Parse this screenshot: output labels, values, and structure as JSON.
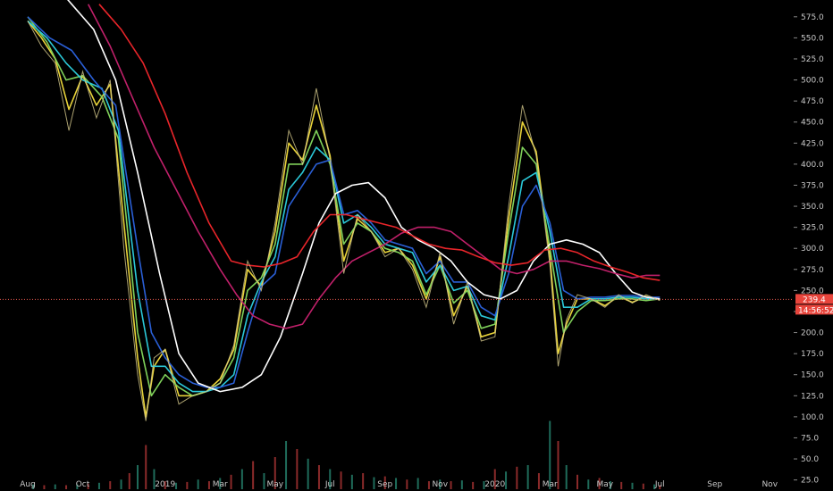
{
  "chart_data": {
    "type": "line",
    "ylim": [
      14,
      578
    ],
    "grid": false,
    "y_ticks": [
      25.0,
      50.0,
      75.0,
      100.0,
      125.0,
      150.0,
      175.0,
      200.0,
      225.0,
      250.0,
      275.0,
      300.0,
      325.0,
      350.0,
      375.0,
      400.0,
      425.0,
      450.0,
      475.0,
      500.0,
      525.0,
      550.0,
      575.0
    ],
    "x_ticks": [
      {
        "t": 0,
        "label": "Aug"
      },
      {
        "t": 2,
        "label": "Oct"
      },
      {
        "t": 5,
        "label": "2019"
      },
      {
        "t": 7,
        "label": "Mar"
      },
      {
        "t": 9,
        "label": "May"
      },
      {
        "t": 11,
        "label": "Jul"
      },
      {
        "t": 13,
        "label": "Sep"
      },
      {
        "t": 15,
        "label": "Nov"
      },
      {
        "t": 17,
        "label": "2020"
      },
      {
        "t": 19,
        "label": "Mar"
      },
      {
        "t": 21,
        "label": "May"
      },
      {
        "t": 23,
        "label": "Jul"
      },
      {
        "t": 25,
        "label": "Sep"
      },
      {
        "t": 27,
        "label": "Nov"
      }
    ],
    "current_price": {
      "value": 239.4,
      "label": "239.4",
      "countdown": "14:56:52"
    },
    "price_series": {
      "color": "#d6c98c",
      "t": [
        0.0,
        0.5,
        1.0,
        1.5,
        2.0,
        2.5,
        3.0,
        3.5,
        4.0,
        4.3,
        4.6,
        5.0,
        5.5,
        6.0,
        6.5,
        7.0,
        7.5,
        8.0,
        8.5,
        9.0,
        9.5,
        10.0,
        10.5,
        11.0,
        11.5,
        12.0,
        12.5,
        13.0,
        13.5,
        14.0,
        14.5,
        15.0,
        15.5,
        16.0,
        16.5,
        17.0,
        17.5,
        18.0,
        18.5,
        19.0,
        19.3,
        19.6,
        20.0,
        20.5,
        21.0,
        21.5,
        22.0,
        22.5,
        23.0
      ],
      "values": [
        570,
        540,
        520,
        440,
        510,
        455,
        500,
        300,
        150,
        95,
        170,
        180,
        115,
        125,
        130,
        140,
        185,
        285,
        250,
        330,
        440,
        400,
        490,
        405,
        270,
        340,
        320,
        290,
        300,
        275,
        230,
        295,
        210,
        260,
        190,
        195,
        350,
        470,
        410,
        280,
        160,
        215,
        245,
        240,
        230,
        245,
        235,
        245,
        238
      ]
    },
    "series": [
      {
        "color": "#e8d33a",
        "t": [
          0.0,
          0.5,
          1.0,
          1.5,
          2.0,
          2.5,
          3.0,
          3.5,
          4.0,
          4.3,
          4.6,
          5.0,
          5.5,
          6.0,
          6.5,
          7.0,
          7.5,
          8.0,
          8.5,
          9.0,
          9.5,
          10.0,
          10.5,
          11.0,
          11.5,
          12.0,
          12.5,
          13.0,
          13.5,
          14.0,
          14.5,
          15.0,
          15.5,
          16.0,
          16.5,
          17.0,
          17.5,
          18.0,
          18.5,
          19.0,
          19.3,
          19.6,
          20.0,
          20.5,
          21.0,
          21.5,
          22.0,
          22.5,
          23.0
        ],
        "values": [
          570,
          550,
          525,
          465,
          505,
          470,
          495,
          330,
          170,
          100,
          160,
          180,
          125,
          125,
          130,
          145,
          180,
          275,
          255,
          320,
          425,
          405,
          470,
          410,
          285,
          335,
          320,
          295,
          300,
          280,
          240,
          290,
          220,
          255,
          195,
          200,
          335,
          450,
          415,
          290,
          175,
          210,
          240,
          240,
          232,
          243,
          236,
          243,
          239
        ]
      },
      {
        "color": "#7fd05a",
        "t": [
          0.0,
          0.7,
          1.4,
          2.0,
          2.7,
          3.3,
          4.0,
          4.5,
          5.0,
          5.5,
          6.0,
          6.5,
          7.0,
          7.5,
          8.0,
          8.5,
          9.0,
          9.5,
          10.0,
          10.5,
          11.0,
          11.5,
          12.0,
          12.5,
          13.0,
          13.5,
          14.0,
          14.5,
          15.0,
          15.5,
          16.0,
          16.5,
          17.0,
          17.5,
          18.0,
          18.5,
          19.0,
          19.5,
          20.0,
          20.5,
          21.0,
          21.5,
          22.0,
          22.5,
          23.0
        ],
        "values": [
          575,
          545,
          500,
          505,
          480,
          430,
          200,
          125,
          150,
          135,
          125,
          130,
          140,
          170,
          250,
          265,
          305,
          400,
          400,
          440,
          400,
          305,
          330,
          320,
          300,
          295,
          285,
          245,
          280,
          235,
          250,
          205,
          210,
          320,
          420,
          400,
          300,
          200,
          225,
          238,
          238,
          240,
          240,
          238,
          240
        ]
      },
      {
        "color": "#2bc8d8",
        "t": [
          0.0,
          0.7,
          1.4,
          2.0,
          2.7,
          3.3,
          4.0,
          4.5,
          5.0,
          5.5,
          6.0,
          6.5,
          7.0,
          7.5,
          8.0,
          8.5,
          9.0,
          9.5,
          10.0,
          10.5,
          11.0,
          11.5,
          12.0,
          12.5,
          13.0,
          13.5,
          14.0,
          14.5,
          15.0,
          15.5,
          16.0,
          16.5,
          17.0,
          17.5,
          18.0,
          18.5,
          19.0,
          19.5,
          20.0,
          20.5,
          21.0,
          21.5,
          22.0,
          22.5,
          23.0
        ],
        "values": [
          570,
          550,
          520,
          500,
          490,
          440,
          250,
          160,
          160,
          140,
          130,
          130,
          135,
          150,
          220,
          260,
          290,
          370,
          390,
          420,
          405,
          330,
          340,
          325,
          305,
          300,
          295,
          260,
          280,
          250,
          255,
          220,
          215,
          290,
          380,
          390,
          320,
          230,
          230,
          240,
          240,
          242,
          242,
          240,
          240
        ]
      },
      {
        "color": "#2a5fd6",
        "t": [
          0.0,
          0.8,
          1.6,
          2.4,
          3.2,
          4.0,
          4.5,
          5.0,
          5.5,
          6.0,
          6.5,
          7.0,
          7.5,
          8.0,
          8.5,
          9.0,
          9.5,
          10.0,
          10.5,
          11.0,
          11.5,
          12.0,
          12.5,
          13.0,
          13.5,
          14.0,
          14.5,
          15.0,
          15.5,
          16.0,
          16.5,
          17.0,
          17.5,
          18.0,
          18.5,
          19.0,
          19.5,
          20.0,
          20.5,
          21.0,
          21.5,
          22.0,
          22.5,
          23.0
        ],
        "values": [
          575,
          550,
          535,
          500,
          470,
          300,
          200,
          170,
          150,
          140,
          135,
          135,
          140,
          200,
          255,
          270,
          350,
          375,
          400,
          405,
          340,
          345,
          330,
          310,
          305,
          300,
          270,
          285,
          260,
          260,
          230,
          220,
          270,
          350,
          375,
          330,
          250,
          240,
          242,
          242,
          244,
          244,
          242,
          242
        ]
      },
      {
        "color": "#ffffff",
        "t": [
          0.0,
          0.8,
          1.6,
          2.4,
          3.2,
          4.0,
          4.8,
          5.5,
          6.2,
          7.0,
          7.8,
          8.5,
          9.2,
          10.0,
          10.6,
          11.2,
          11.8,
          12.4,
          13.0,
          13.6,
          14.2,
          14.8,
          15.4,
          16.0,
          16.6,
          17.2,
          17.8,
          18.4,
          19.0,
          19.6,
          20.2,
          20.8,
          21.4,
          22.0,
          22.5,
          23.0
        ],
        "values": [
          660,
          620,
          590,
          560,
          500,
          390,
          270,
          175,
          140,
          130,
          135,
          150,
          195,
          270,
          330,
          365,
          375,
          378,
          360,
          325,
          310,
          300,
          285,
          260,
          245,
          240,
          250,
          285,
          305,
          310,
          305,
          295,
          270,
          248,
          242,
          240
        ]
      },
      {
        "color": "#c0206a",
        "t": [
          2.2,
          3.0,
          3.8,
          4.6,
          5.4,
          6.2,
          7.0,
          7.6,
          8.2,
          8.8,
          9.4,
          10.0,
          10.6,
          11.2,
          11.8,
          12.4,
          13.0,
          13.6,
          14.2,
          14.8,
          15.4,
          16.0,
          16.6,
          17.2,
          17.8,
          18.4,
          19.0,
          19.6,
          20.2,
          20.8,
          21.4,
          22.0,
          22.5,
          23.0
        ],
        "values": [
          590,
          540,
          480,
          420,
          370,
          320,
          275,
          245,
          220,
          210,
          205,
          210,
          240,
          265,
          285,
          295,
          305,
          318,
          325,
          325,
          320,
          305,
          290,
          275,
          270,
          275,
          285,
          285,
          280,
          276,
          270,
          265,
          268,
          268
        ]
      },
      {
        "color": "#e8252a",
        "t": [
          2.6,
          3.4,
          4.2,
          5.0,
          5.8,
          6.6,
          7.4,
          8.0,
          8.6,
          9.2,
          9.8,
          10.4,
          11.0,
          11.6,
          12.2,
          12.8,
          13.4,
          14.0,
          14.6,
          15.2,
          15.8,
          16.4,
          17.0,
          17.6,
          18.2,
          18.8,
          19.4,
          20.0,
          20.6,
          21.2,
          21.8,
          22.4,
          23.0
        ],
        "values": [
          590,
          560,
          520,
          460,
          390,
          330,
          285,
          280,
          278,
          282,
          290,
          320,
          340,
          340,
          335,
          330,
          325,
          315,
          305,
          300,
          298,
          290,
          283,
          280,
          283,
          298,
          300,
          295,
          285,
          278,
          272,
          265,
          262
        ]
      }
    ],
    "volume": {
      "t": [
        0.2,
        0.6,
        1.0,
        1.4,
        1.8,
        2.2,
        2.6,
        3.0,
        3.4,
        3.7,
        4.0,
        4.3,
        4.6,
        5.0,
        5.4,
        5.8,
        6.2,
        6.6,
        7.0,
        7.4,
        7.8,
        8.2,
        8.6,
        9.0,
        9.4,
        9.8,
        10.2,
        10.6,
        11.0,
        11.4,
        11.8,
        12.2,
        12.6,
        13.0,
        13.4,
        13.8,
        14.2,
        14.6,
        15.0,
        15.4,
        15.8,
        16.2,
        16.6,
        17.0,
        17.4,
        17.8,
        18.2,
        18.6,
        19.0,
        19.3,
        19.6,
        20.0,
        20.4,
        20.8,
        21.2,
        21.6,
        22.0,
        22.4,
        22.8,
        23.0
      ],
      "values": [
        6,
        5,
        6,
        5,
        6,
        7,
        8,
        10,
        12,
        20,
        30,
        55,
        25,
        10,
        8,
        9,
        12,
        10,
        14,
        18,
        25,
        35,
        20,
        40,
        60,
        50,
        38,
        30,
        25,
        22,
        18,
        20,
        15,
        16,
        14,
        12,
        14,
        10,
        12,
        10,
        11,
        9,
        10,
        25,
        22,
        28,
        30,
        20,
        85,
        60,
        30,
        18,
        12,
        14,
        10,
        9,
        8,
        7,
        6,
        5
      ]
    }
  }
}
